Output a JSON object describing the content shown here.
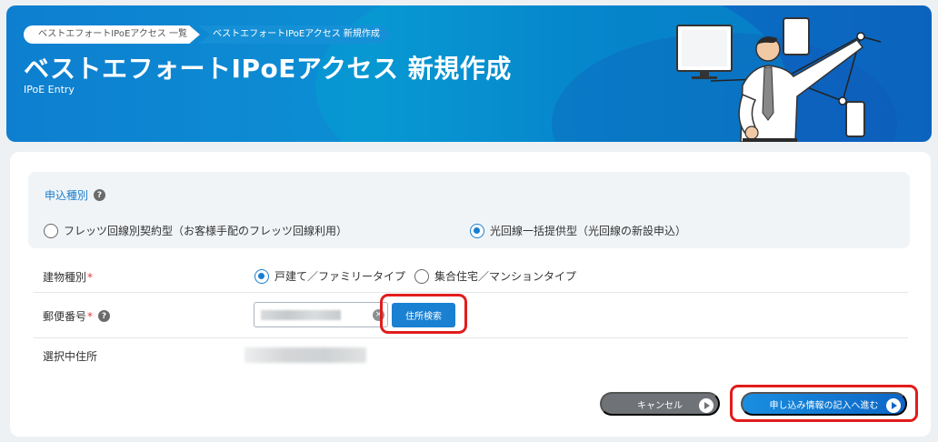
{
  "header": {
    "breadcrumb_parent": "ベストエフォートIPoEアクセス 一覧",
    "breadcrumb_current": "ベストエフォートIPoEアクセス 新規作成",
    "title": "ベストエフォートIPoEアクセス 新規作成",
    "subtitle": "IPoE Entry"
  },
  "application_type": {
    "label": "申込種別",
    "help_icon": "?",
    "options": [
      {
        "label": "フレッツ回線別契約型（お客様手配のフレッツ回線利用）",
        "selected": false
      },
      {
        "label": "光回線一括提供型（光回線の新設申込）",
        "selected": true
      }
    ]
  },
  "building_type": {
    "label": "建物種別",
    "required_mark": "*",
    "options": [
      {
        "label": "戸建て／ファミリータイプ",
        "selected": true
      },
      {
        "label": "集合住宅／マンションタイプ",
        "selected": false
      }
    ]
  },
  "postal_code": {
    "label": "郵便番号",
    "required_mark": "*",
    "help_icon": "?",
    "value": "",
    "clear_icon": "×",
    "search_button": "住所検索"
  },
  "selected_address": {
    "label": "選択中住所",
    "value": ""
  },
  "actions": {
    "cancel": "キャンセル",
    "next": "申し込み情報の記入へ進む"
  },
  "colors": {
    "accent": "#1a80d2",
    "highlight": "#e21c1c",
    "required": "#e53935"
  }
}
